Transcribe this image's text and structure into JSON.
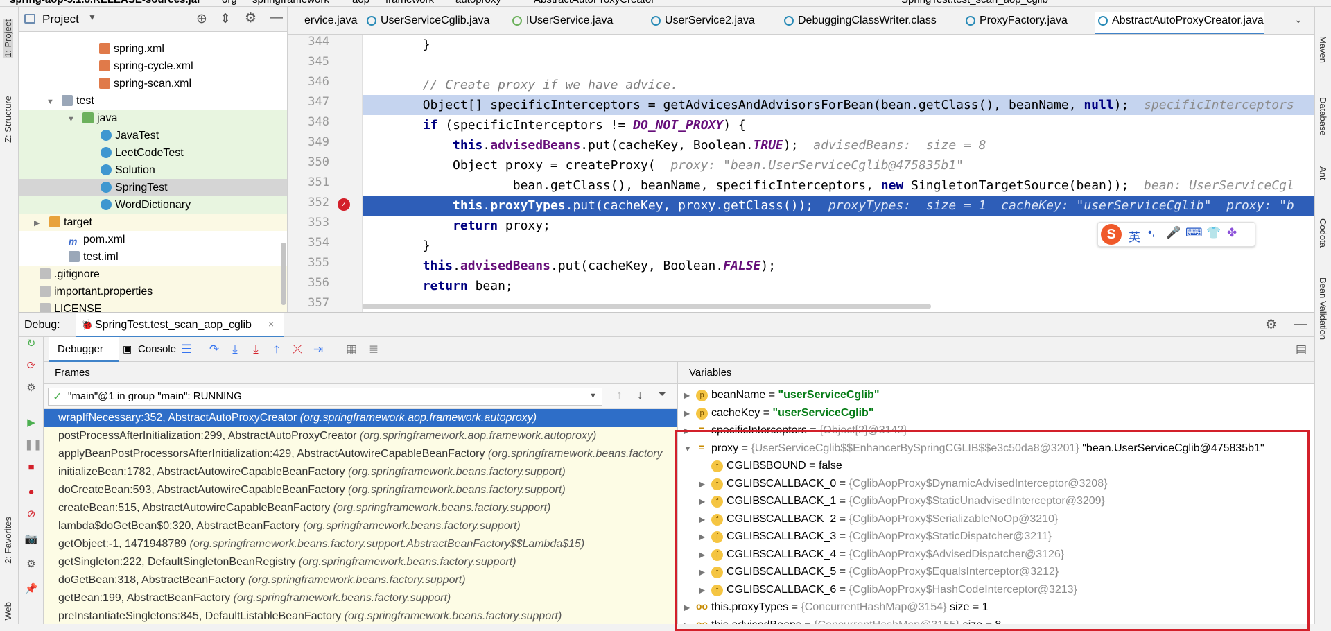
{
  "breadcrumb": [
    "spring-aop-5.1.8.RELEASE-sources.jar",
    "org",
    "springframework",
    "aop",
    "framework",
    "autoproxy",
    "AbstractAutoProxyCreator"
  ],
  "run_config": "SpringTest.test_scan_aop_cglib",
  "left_stripe": {
    "project": "1: Project",
    "structure": "Z: Structure",
    "favorites": "2: Favorites",
    "web": "Web"
  },
  "right_stripe": {
    "maven": "Maven",
    "database": "Database",
    "ant": "Ant",
    "codota": "Codota",
    "bean_validation": "Bean Validation"
  },
  "project_panel": {
    "title": "Project",
    "items": [
      {
        "label": "spring.xml",
        "icon": "xml-file-icon"
      },
      {
        "label": "spring-cycle.xml",
        "icon": "xml-file-icon"
      },
      {
        "label": "spring-scan.xml",
        "icon": "xml-file-icon"
      },
      {
        "label": "test",
        "icon": "folder-icon"
      },
      {
        "label": "java",
        "icon": "source-folder-icon"
      },
      {
        "label": "JavaTest",
        "icon": "class-icon"
      },
      {
        "label": "LeetCodeTest",
        "icon": "class-icon"
      },
      {
        "label": "Solution",
        "icon": "class-icon"
      },
      {
        "label": "SpringTest",
        "icon": "class-icon"
      },
      {
        "label": "WordDictionary",
        "icon": "class-icon"
      },
      {
        "label": "target",
        "icon": "folder-icon"
      },
      {
        "label": "pom.xml",
        "icon": "maven-icon"
      },
      {
        "label": "test.iml",
        "icon": "iml-file-icon"
      },
      {
        "label": ".gitignore",
        "icon": "text-file-icon"
      },
      {
        "label": "important.properties",
        "icon": "properties-file-icon"
      },
      {
        "label": "LICENSE",
        "icon": "text-file-icon"
      }
    ]
  },
  "editor_tabs": [
    {
      "label": "ervice.java",
      "active": false
    },
    {
      "label": "UserServiceCglib.java",
      "active": false
    },
    {
      "label": "IUserService.java",
      "active": false
    },
    {
      "label": "UserService2.java",
      "active": false
    },
    {
      "label": "DebuggingClassWriter.class",
      "active": false
    },
    {
      "label": "ProxyFactory.java",
      "active": false
    },
    {
      "label": "AbstractAutoProxyCreator.java",
      "active": true
    }
  ],
  "code": {
    "line_numbers": [
      "344",
      "345",
      "346",
      "347",
      "348",
      "349",
      "350",
      "351",
      "352",
      "353",
      "354",
      "355",
      "356",
      "357"
    ],
    "l344": "        }",
    "l346": "        // Create proxy if we have advice.",
    "l347a": "        Object[] specificInterceptors = getAdvicesAndAdvisorsForBean(bean.getClass(), beanName, ",
    "l347b": "null",
    "l347c": ");  ",
    "l347h": "specificInterceptors",
    "l348a": "        ",
    "l348b": "if",
    "l348c": " (specificInterceptors != ",
    "l348d": "DO_NOT_PROXY",
    "l348e": ") {",
    "l349a": "            ",
    "l349b": "this",
    "l349c": ".",
    "l349d": "advisedBeans",
    "l349e": ".put(cacheKey, Boolean.",
    "l349f": "TRUE",
    "l349g": ");  ",
    "l349h": "advisedBeans:  size = 8",
    "l350a": "            Object proxy = createProxy(  ",
    "l350h": "proxy: \"bean.UserServiceCglib@475835b1\"",
    "l351a": "                    bean.getClass(), beanName, specificInterceptors, ",
    "l351b": "new",
    "l351c": " SingletonTargetSource(bean));  ",
    "l351h": "bean: UserServiceCgl",
    "l352a": "            ",
    "l352b": "this",
    "l352c": ".",
    "l352d": "proxyTypes",
    "l352e": ".put(cacheKey, proxy.getClass());  ",
    "l352h": "proxyTypes:  size = 1  cacheKey: \"userServiceCglib\"  proxy: \"b",
    "l353a": "            ",
    "l353b": "return",
    "l353c": " proxy;",
    "l354": "        }",
    "l356a": "        ",
    "l356b": "this",
    "l356c": ".",
    "l356d": "advisedBeans",
    "l356e": ".put(cacheKey, Boolean.",
    "l356f": "FALSE",
    "l356g": ");",
    "l357a": "        ",
    "l357b": "return",
    "l357c": " bean;"
  },
  "ime_toolbar": {
    "lang": "英"
  },
  "debug": {
    "label": "Debug:",
    "session": "SpringTest.test_scan_aop_cglib",
    "tab_debugger": "Debugger",
    "tab_console": "Console",
    "frames_header": "Frames",
    "variables_header": "Variables",
    "thread": "\"main\"@1 in group \"main\": RUNNING",
    "frames": [
      {
        "method": "wrapIfNecessary:352, AbstractAutoProxyCreator ",
        "pkg": "(org.springframework.aop.framework.autoproxy)",
        "selected": true
      },
      {
        "method": "postProcessAfterInitialization:299, AbstractAutoProxyCreator ",
        "pkg": "(org.springframework.aop.framework.autoproxy)",
        "selected": false
      },
      {
        "method": "applyBeanPostProcessorsAfterInitialization:429, AbstractAutowireCapableBeanFactory ",
        "pkg": "(org.springframework.beans.factory",
        "selected": false
      },
      {
        "method": "initializeBean:1782, AbstractAutowireCapableBeanFactory ",
        "pkg": "(org.springframework.beans.factory.support)",
        "selected": false
      },
      {
        "method": "doCreateBean:593, AbstractAutowireCapableBeanFactory ",
        "pkg": "(org.springframework.beans.factory.support)",
        "selected": false
      },
      {
        "method": "createBean:515, AbstractAutowireCapableBeanFactory ",
        "pkg": "(org.springframework.beans.factory.support)",
        "selected": false
      },
      {
        "method": "lambda$doGetBean$0:320, AbstractBeanFactory ",
        "pkg": "(org.springframework.beans.factory.support)",
        "selected": false
      },
      {
        "method": "getObject:-1, 1471948789 ",
        "pkg": "(org.springframework.beans.factory.support.AbstractBeanFactory$$Lambda$15)",
        "selected": false
      },
      {
        "method": "getSingleton:222, DefaultSingletonBeanRegistry ",
        "pkg": "(org.springframework.beans.factory.support)",
        "selected": false
      },
      {
        "method": "doGetBean:318, AbstractBeanFactory ",
        "pkg": "(org.springframework.beans.factory.support)",
        "selected": false
      },
      {
        "method": "getBean:199, AbstractBeanFactory ",
        "pkg": "(org.springframework.beans.factory.support)",
        "selected": false
      },
      {
        "method": "preInstantiateSingletons:845, DefaultListableBeanFactory ",
        "pkg": "(org.springframework.beans.factory.support)",
        "selected": false
      }
    ],
    "variables": [
      {
        "arrow": "▶",
        "badge": "p",
        "name": "beanName",
        "eq": " = ",
        "type": "",
        "value": "\"userServiceCglib\"",
        "indent": 0
      },
      {
        "arrow": "▶",
        "badge": "p",
        "name": "cacheKey",
        "eq": " = ",
        "type": "",
        "value": "\"userServiceCglib\"",
        "indent": 0
      },
      {
        "arrow": "▶",
        "badge": "=",
        "name": "specificInterceptors",
        "eq": " = ",
        "type": "{Object[2]@3142}",
        "value": "",
        "indent": 0
      },
      {
        "arrow": "▼",
        "badge": "=",
        "name": "proxy",
        "eq": " = ",
        "type": "{UserServiceCglib$$EnhancerBySpringCGLIB$$e3c50da8@3201} ",
        "value": "\"bean.UserServiceCglib@475835b1\"",
        "indent": 0
      },
      {
        "arrow": "",
        "badge": "f",
        "name": "CGLIB$BOUND",
        "eq": " = ",
        "type": "",
        "value": "false",
        "indent": 1
      },
      {
        "arrow": "▶",
        "badge": "f",
        "name": "CGLIB$CALLBACK_0",
        "eq": " = ",
        "type": "{CglibAopProxy$DynamicAdvisedInterceptor@3208}",
        "value": "",
        "indent": 1
      },
      {
        "arrow": "▶",
        "badge": "f",
        "name": "CGLIB$CALLBACK_1",
        "eq": " = ",
        "type": "{CglibAopProxy$StaticUnadvisedInterceptor@3209}",
        "value": "",
        "indent": 1
      },
      {
        "arrow": "▶",
        "badge": "f",
        "name": "CGLIB$CALLBACK_2",
        "eq": " = ",
        "type": "{CglibAopProxy$SerializableNoOp@3210}",
        "value": "",
        "indent": 1
      },
      {
        "arrow": "▶",
        "badge": "f",
        "name": "CGLIB$CALLBACK_3",
        "eq": " = ",
        "type": "{CglibAopProxy$StaticDispatcher@3211}",
        "value": "",
        "indent": 1
      },
      {
        "arrow": "▶",
        "badge": "f",
        "name": "CGLIB$CALLBACK_4",
        "eq": " = ",
        "type": "{CglibAopProxy$AdvisedDispatcher@3126}",
        "value": "",
        "indent": 1
      },
      {
        "arrow": "▶",
        "badge": "f",
        "name": "CGLIB$CALLBACK_5",
        "eq": " = ",
        "type": "{CglibAopProxy$EqualsInterceptor@3212}",
        "value": "",
        "indent": 1
      },
      {
        "arrow": "▶",
        "badge": "f",
        "name": "CGLIB$CALLBACK_6",
        "eq": " = ",
        "type": "{CglibAopProxy$HashCodeInterceptor@3213}",
        "value": "",
        "indent": 1
      },
      {
        "arrow": "▶",
        "badge": "oo",
        "name": "this.proxyTypes",
        "eq": " = ",
        "type": "{ConcurrentHashMap@3154} ",
        "value": " size = 1",
        "indent": 0
      },
      {
        "arrow": "▶",
        "badge": "oo",
        "name": "this.advisedBeans",
        "eq": " = ",
        "type": "{ConcurrentHashMap@3155} ",
        "value": " size = 8",
        "indent": 0
      }
    ]
  },
  "colors": {
    "selection": "#2e6ec8",
    "highlight_line": "#c5d4ef",
    "breakpoint": "#d3202a",
    "red_box": "#d3202a"
  }
}
